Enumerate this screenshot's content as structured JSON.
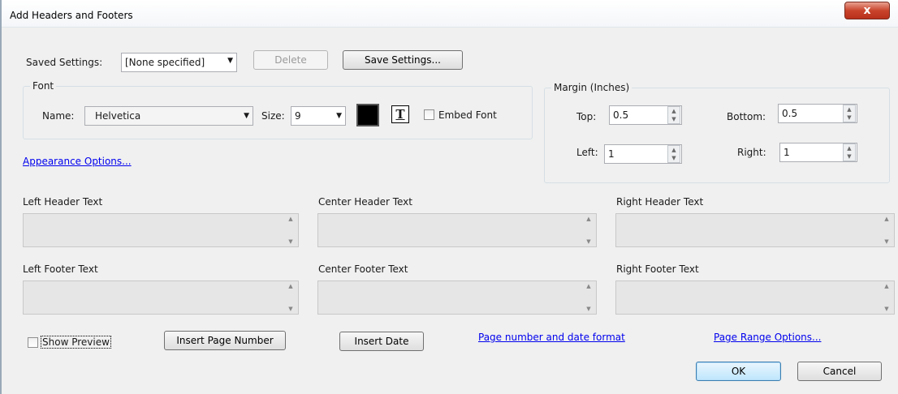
{
  "title": "Add Headers and Footers",
  "close_glyph": "x",
  "saved_settings": {
    "label": "Saved Settings:",
    "value": "[None specified]",
    "delete_label": "Delete",
    "save_label": "Save Settings..."
  },
  "font": {
    "group_label": "Font",
    "name_label": "Name:",
    "name_value": "Helvetica",
    "size_label": "Size:",
    "size_value": "9",
    "color": "#000000",
    "text_icon_glyph": "T",
    "embed_label": "Embed Font"
  },
  "appearance_link": "Appearance Options...",
  "margin": {
    "group_label": "Margin (Inches)",
    "top_label": "Top:",
    "top_value": "0.5",
    "bottom_label": "Bottom:",
    "bottom_value": "0.5",
    "left_label": "Left:",
    "left_value": "1",
    "right_label": "Right:",
    "right_value": "1"
  },
  "header_labels": {
    "left": "Left Header Text",
    "center": "Center Header Text",
    "right": "Right Header Text"
  },
  "footer_labels": {
    "left": "Left Footer Text",
    "center": "Center Footer Text",
    "right": "Right Footer Text"
  },
  "bottom": {
    "show_preview": "Show Preview",
    "insert_page_number": "Insert Page Number",
    "insert_date": "Insert Date",
    "page_number_format_link": "Page number and date format",
    "page_range_link": "Page Range Options..."
  },
  "ok_label": "OK",
  "cancel_label": "Cancel"
}
